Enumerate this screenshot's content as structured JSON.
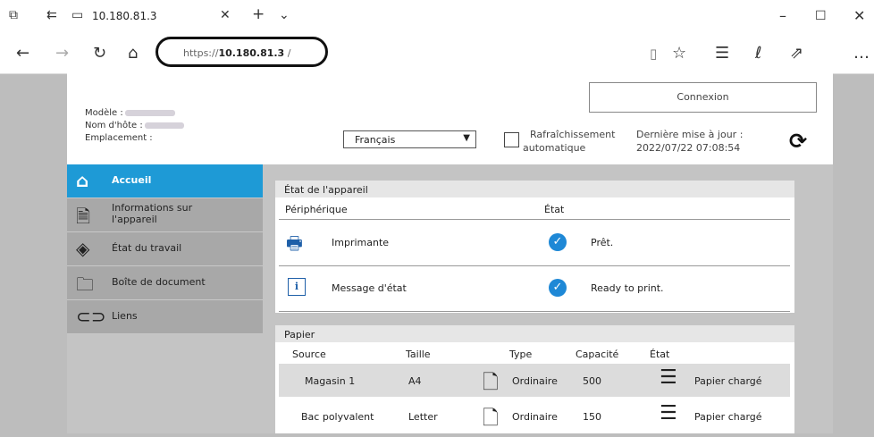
{
  "browser": {
    "tab_title": "10.180.81.3",
    "url_prefix": "https://",
    "url_host": "10.180.81.3",
    "url_suffix": " /"
  },
  "header": {
    "model_label": "Modèle :",
    "hostname_label": "Nom d'hôte :",
    "location_label": "Emplacement :",
    "language": "Français",
    "auto_refresh_line1": "Rafraîchissement",
    "auto_refresh_line2": "automatique",
    "login_label": "Connexion",
    "last_update_label": "Dernière mise à jour :",
    "last_update_value": "2022/07/22 07:08:54"
  },
  "sidebar": {
    "items": [
      {
        "label": "Accueil",
        "icon": "home-icon"
      },
      {
        "label1": "Informations sur",
        "label2": "l'appareil",
        "icon": "device-info-icon"
      },
      {
        "label": "État du travail",
        "icon": "eye-icon"
      },
      {
        "label": "Boîte de document",
        "icon": "folder-icon"
      },
      {
        "label": "Liens",
        "icon": "link-icon"
      }
    ]
  },
  "device_status": {
    "title": "État de l'appareil",
    "col_device": "Périphérique",
    "col_state": "État",
    "rows": [
      {
        "name": "Imprimante",
        "state": "Prêt.",
        "icon": "printer-icon"
      },
      {
        "name": "Message d'état",
        "state": "Ready to print.",
        "icon": "info-icon"
      }
    ]
  },
  "paper": {
    "title": "Papier",
    "columns": [
      "Source",
      "Taille",
      "Type",
      "Capacité",
      "État"
    ],
    "rows": [
      {
        "source": "Magasin 1",
        "size": "A4",
        "type": "Ordinaire",
        "capacity": "500",
        "state": "Papier chargé"
      },
      {
        "source": "Bac polyvalent",
        "size": "Letter",
        "type": "Ordinaire",
        "capacity": "150",
        "state": "Papier chargé"
      }
    ]
  }
}
